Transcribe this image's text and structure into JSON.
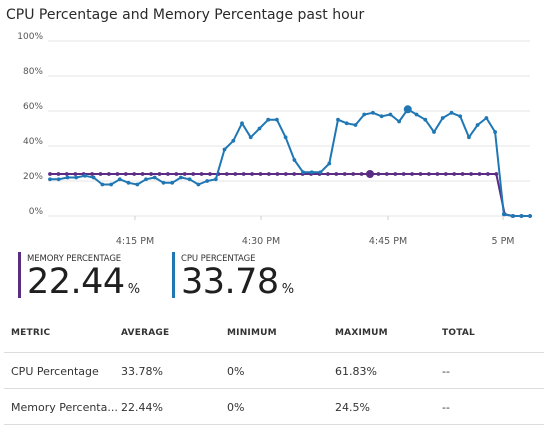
{
  "title": "CPU Percentage and Memory Percentage past hour",
  "colors": {
    "cpu": "#1f77b4",
    "memory": "#5b2c83",
    "grid": "#e6e6e6"
  },
  "chart_data": {
    "type": "line",
    "y_ticks": [
      "0%",
      "20%",
      "40%",
      "60%",
      "80%",
      "100%"
    ],
    "x_ticks": [
      "4:15 PM",
      "4:30 PM",
      "4:45 PM",
      "5 PM"
    ],
    "ylim": [
      0,
      100
    ],
    "grid": true,
    "series": [
      {
        "name": "CPU Percentage",
        "color": "#1f77b4",
        "values": [
          21,
          21,
          22,
          22,
          23,
          22,
          18,
          18,
          21,
          19,
          18,
          21,
          22,
          19,
          19,
          22,
          21,
          18,
          20,
          21,
          38,
          43,
          53,
          45,
          50,
          55,
          55,
          45,
          32,
          25,
          25,
          25,
          30,
          55,
          53,
          52,
          58,
          59,
          57,
          58,
          54,
          61,
          58,
          55,
          48,
          56,
          59,
          57,
          45,
          52,
          56,
          48,
          1,
          0,
          0,
          0
        ],
        "highlight_index": 41
      },
      {
        "name": "Memory Percentage",
        "color": "#5b2c83",
        "values": [
          24,
          24,
          24,
          24,
          24,
          24,
          24,
          24,
          24,
          24,
          24,
          24,
          24,
          24,
          24,
          24,
          24,
          24,
          24,
          24,
          24,
          24,
          24,
          24,
          24,
          24,
          24,
          24,
          24,
          24,
          24,
          24,
          24,
          24,
          24,
          24,
          24,
          24,
          24,
          24,
          24,
          24,
          24,
          24,
          24,
          24,
          24,
          24,
          24,
          24,
          24,
          24,
          24,
          24,
          1,
          0,
          0,
          0
        ],
        "highlight_index": 38
      }
    ]
  },
  "summary": {
    "memory": {
      "label": "MEMORY PERCENTAGE",
      "value": "22.44",
      "unit": "%"
    },
    "cpu": {
      "label": "CPU PERCENTAGE",
      "value": "33.78",
      "unit": "%"
    }
  },
  "table": {
    "headers": [
      "METRIC",
      "AVERAGE",
      "MINIMUM",
      "MAXIMUM",
      "TOTAL"
    ],
    "rows": [
      {
        "metric": "CPU Percentage",
        "average": "33.78%",
        "minimum": "0%",
        "maximum": "61.83%",
        "total": "--"
      },
      {
        "metric": "Memory Percenta...",
        "average": "22.44%",
        "minimum": "0%",
        "maximum": "24.5%",
        "total": "--"
      }
    ]
  }
}
